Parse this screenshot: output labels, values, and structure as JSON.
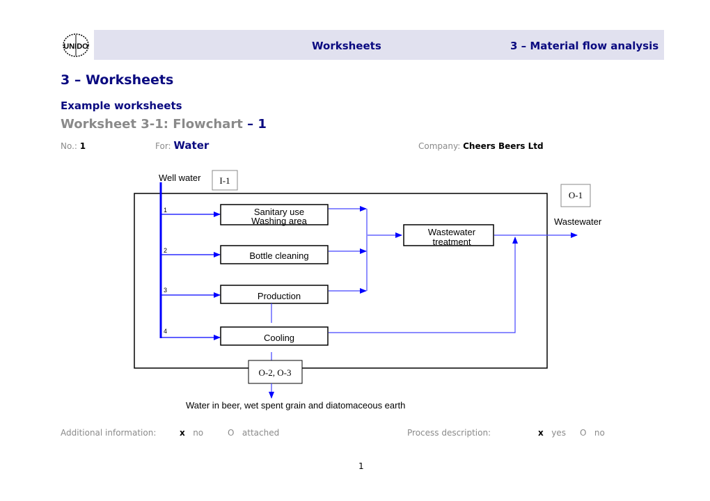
{
  "header": {
    "logo_text": "UNIDO",
    "center_title": "Worksheets",
    "right_title": "3 – Material flow analysis"
  },
  "headings": {
    "section": "3 – Worksheets",
    "subsection": "Example worksheets",
    "worksheet_title_prefix": "Worksheet 3-1: Flowchart ",
    "worksheet_title_suffix": "– 1"
  },
  "meta": {
    "no_label": "No.:",
    "no_value": "1",
    "for_label": "For:",
    "for_value": "Water",
    "company_label": "Company:",
    "company_value": "Cheers Beers Ltd"
  },
  "flowchart": {
    "input_label": "Well water",
    "input_code": "I-1",
    "output_code_right": "O-1",
    "output_label_right": "Wastewater",
    "output_code_bottom": "O-2, O-3",
    "output_label_bottom": "Water in beer, wet spent grain and diatomaceous earth",
    "branches": [
      "1",
      "2",
      "3",
      "4"
    ],
    "processes": [
      {
        "line1": "Sanitary use",
        "line2": "Washing area"
      },
      {
        "line1": "Bottle cleaning"
      },
      {
        "line1": "Production"
      },
      {
        "line1": "Cooling"
      }
    ],
    "treatment": {
      "line1": "Wastewater",
      "line2": "treatment"
    },
    "colors": {
      "flow": "#0000ff",
      "box": "#000000"
    }
  },
  "footer": {
    "additional_label": "Additional information:",
    "additional_checked_mark": "x",
    "additional_checked": "no",
    "additional_unchecked_mark": "O",
    "additional_unchecked": "attached",
    "process_label": "Process description:",
    "process_checked_mark": "x",
    "process_checked": "yes",
    "process_unchecked_mark": "O",
    "process_unchecked": "no"
  },
  "page_number": "1"
}
